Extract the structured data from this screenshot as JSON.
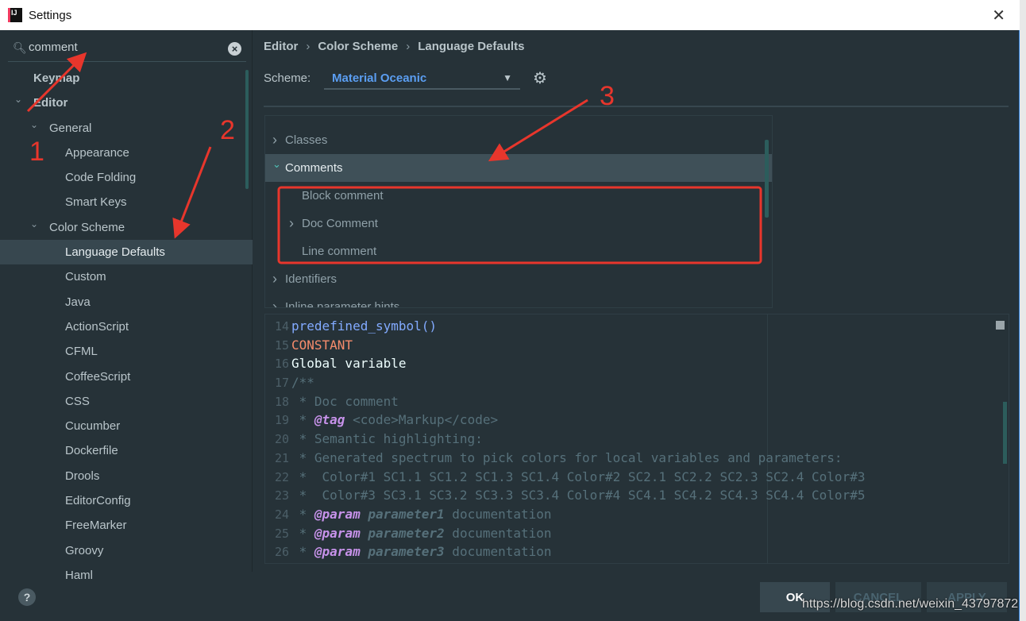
{
  "window": {
    "title": "Settings"
  },
  "search": {
    "value": "comment"
  },
  "tree": [
    {
      "label": "Keymap",
      "level": 0,
      "bold": true
    },
    {
      "label": "Editor",
      "level": 0,
      "bold": true,
      "expanded": true
    },
    {
      "label": "General",
      "level": 1,
      "expanded": true
    },
    {
      "label": "Appearance",
      "level": 2
    },
    {
      "label": "Code Folding",
      "level": 2
    },
    {
      "label": "Smart Keys",
      "level": 2
    },
    {
      "label": "Color Scheme",
      "level": 1,
      "expanded": true
    },
    {
      "label": "Language Defaults",
      "level": 2,
      "selected": true
    },
    {
      "label": "Custom",
      "level": 2
    },
    {
      "label": "Java",
      "level": 2
    },
    {
      "label": "ActionScript",
      "level": 2
    },
    {
      "label": "CFML",
      "level": 2
    },
    {
      "label": "CoffeeScript",
      "level": 2
    },
    {
      "label": "CSS",
      "level": 2
    },
    {
      "label": "Cucumber",
      "level": 2
    },
    {
      "label": "Dockerfile",
      "level": 2
    },
    {
      "label": "Drools",
      "level": 2
    },
    {
      "label": "EditorConfig",
      "level": 2
    },
    {
      "label": "FreeMarker",
      "level": 2
    },
    {
      "label": "Groovy",
      "level": 2
    },
    {
      "label": "Haml",
      "level": 2
    }
  ],
  "breadcrumb": [
    "Editor",
    "Color Scheme",
    "Language Defaults"
  ],
  "scheme": {
    "label": "Scheme:",
    "value": "Material Oceanic"
  },
  "attributes": [
    {
      "label": "Classes",
      "indent": 0,
      "arrow": "right"
    },
    {
      "label": "Comments",
      "indent": 0,
      "arrow": "down",
      "selected": true
    },
    {
      "label": "Block comment",
      "indent": 1
    },
    {
      "label": "Doc Comment",
      "indent": 1,
      "arrow": "right"
    },
    {
      "label": "Line comment",
      "indent": 1
    },
    {
      "label": "Identifiers",
      "indent": 0,
      "arrow": "right"
    },
    {
      "label": "Inline parameter hints",
      "indent": 0,
      "arrow": "right"
    }
  ],
  "code": [
    {
      "n": "14",
      "parts": [
        [
          "f",
          "predefined_symbol()"
        ]
      ]
    },
    {
      "n": "15",
      "parts": [
        [
          "k",
          "CONSTANT"
        ]
      ]
    },
    {
      "n": "16",
      "parts": [
        [
          "g",
          "Global variable"
        ]
      ]
    },
    {
      "n": "17",
      "parts": [
        [
          "c",
          "/**"
        ]
      ]
    },
    {
      "n": "18",
      "parts": [
        [
          "c",
          " * Doc comment"
        ]
      ]
    },
    {
      "n": "19",
      "parts": [
        [
          "c",
          " * "
        ],
        [
          "tag",
          "@tag"
        ],
        [
          "c",
          " <code>Markup</code>"
        ]
      ]
    },
    {
      "n": "20",
      "parts": [
        [
          "c",
          " * Semantic highlighting:"
        ]
      ]
    },
    {
      "n": "21",
      "parts": [
        [
          "c",
          " * Generated spectrum to pick colors for local variables and parameters:"
        ]
      ]
    },
    {
      "n": "22",
      "parts": [
        [
          "c",
          " *  Color#1 SC1.1 SC1.2 SC1.3 SC1.4 Color#2 SC2.1 SC2.2 SC2.3 SC2.4 Color#3"
        ]
      ]
    },
    {
      "n": "23",
      "parts": [
        [
          "c",
          " *  Color#3 SC3.1 SC3.2 SC3.3 SC3.4 Color#4 SC4.1 SC4.2 SC4.3 SC4.4 Color#5"
        ]
      ]
    },
    {
      "n": "24",
      "parts": [
        [
          "c",
          " * "
        ],
        [
          "tag",
          "@param"
        ],
        [
          "c",
          " "
        ],
        [
          "pi",
          "parameter1"
        ],
        [
          "c",
          " documentation"
        ]
      ]
    },
    {
      "n": "25",
      "parts": [
        [
          "c",
          " * "
        ],
        [
          "tag",
          "@param"
        ],
        [
          "c",
          " "
        ],
        [
          "pi",
          "parameter2"
        ],
        [
          "c",
          " documentation"
        ]
      ]
    },
    {
      "n": "26",
      "parts": [
        [
          "c",
          " * "
        ],
        [
          "tag",
          "@param"
        ],
        [
          "c",
          " "
        ],
        [
          "pi",
          "parameter3"
        ],
        [
          "c",
          " documentation"
        ]
      ]
    }
  ],
  "buttons": {
    "help": "?",
    "ok": "OK",
    "cancel": "CANCEL",
    "apply": "APPLY"
  },
  "annotations": {
    "n1": "1",
    "n2": "2",
    "n3": "3",
    "color": "#e8362c"
  },
  "watermark": "https://blog.csdn.net/weixin_43797872"
}
